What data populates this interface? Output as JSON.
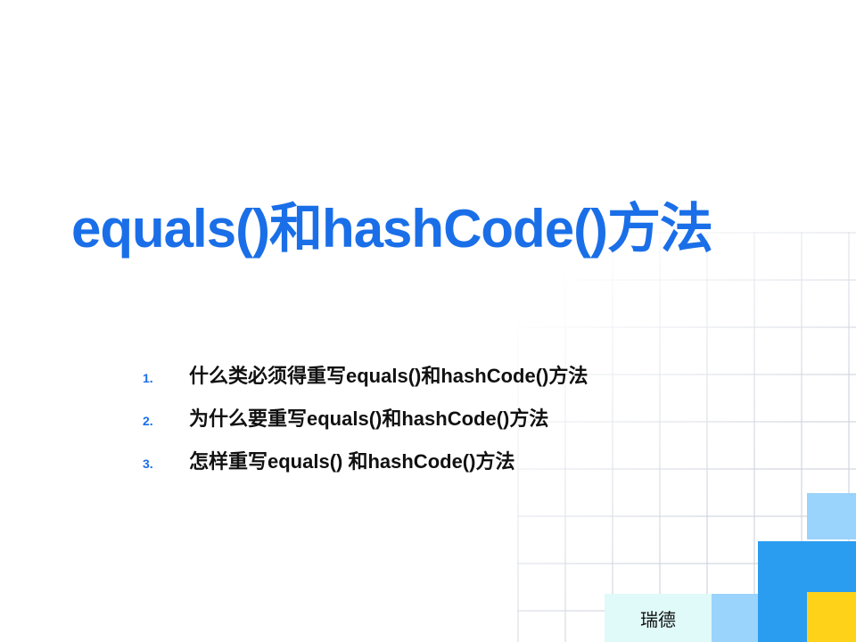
{
  "slide": {
    "title": "equals()和hashCode()方法",
    "items": [
      {
        "number": "1.",
        "text": "什么类必须得重写equals()和hashCode()方法"
      },
      {
        "number": "2.",
        "text": "为什么要重写equals()和hashCode()方法"
      },
      {
        "number": "3.",
        "text": "怎样重写equals() 和hashCode()方法"
      }
    ],
    "footer": "瑞德"
  },
  "colors": {
    "title": "#1a6fe8",
    "block_light_blue": "#9ad3fb",
    "block_blue": "#2b9df0",
    "block_yellow": "#ffd21a",
    "footer_bg": "#dffaf8"
  }
}
